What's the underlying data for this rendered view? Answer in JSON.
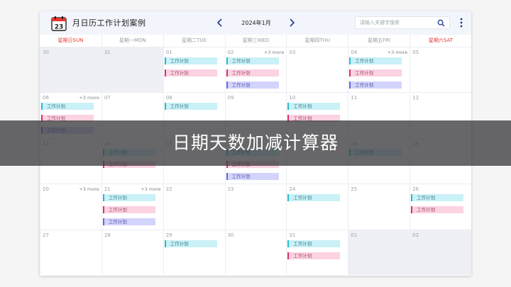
{
  "app": {
    "title": "月日历工作计划案例",
    "logo_day": "23",
    "current_month": "2024年1月",
    "search_placeholder": "请输入关键字搜索",
    "search_value": ""
  },
  "weekdays": [
    "星期日SUN",
    "星期一MON",
    "星期二TUE",
    "星期三WED",
    "星期四THU",
    "星期五FRI",
    "星期六SAT"
  ],
  "weekend_color": "#e53935",
  "event_colors": {
    "cyan": "#27b9cf",
    "pink": "#e02a6c",
    "purple": "#6366e8"
  },
  "weeks": [
    [
      {
        "day": "30",
        "other": true,
        "events": []
      },
      {
        "day": "31",
        "other": true,
        "events": []
      },
      {
        "day": "01",
        "events": [
          {
            "label": "工作计划",
            "color": "cyan"
          },
          {
            "label": "工作计划",
            "color": "pink"
          }
        ]
      },
      {
        "day": "02",
        "more": "+3 more",
        "events": [
          {
            "label": "工作计划",
            "color": "cyan"
          },
          {
            "label": "工作计划",
            "color": "pink"
          },
          {
            "label": "工作计划",
            "color": "purple"
          }
        ]
      },
      {
        "day": "03",
        "events": []
      },
      {
        "day": "04",
        "more": "+3 more",
        "events": [
          {
            "label": "工作计划",
            "color": "cyan"
          },
          {
            "label": "工作计划",
            "color": "pink"
          },
          {
            "label": "工作计划",
            "color": "purple"
          }
        ]
      },
      {
        "day": "05",
        "events": []
      }
    ],
    [
      {
        "day": "06",
        "more": "+3 more",
        "events": [
          {
            "label": "工作计划",
            "color": "cyan"
          },
          {
            "label": "工作计划",
            "color": "pink"
          },
          {
            "label": "工作计划",
            "color": "purple"
          }
        ]
      },
      {
        "day": "07",
        "events": []
      },
      {
        "day": "08",
        "events": [
          {
            "label": "工作计划",
            "color": "cyan"
          }
        ]
      },
      {
        "day": "09",
        "events": []
      },
      {
        "day": "10",
        "events": [
          {
            "label": "工作计划",
            "color": "cyan"
          },
          {
            "label": "工作计划",
            "color": "pink"
          }
        ]
      },
      {
        "day": "11",
        "events": []
      },
      {
        "day": "12",
        "events": []
      }
    ],
    [
      {
        "day": "13",
        "events": []
      },
      {
        "day": "14",
        "events": [
          {
            "label": "工作计划",
            "color": "cyan"
          },
          {
            "label": "工作计划",
            "color": "pink"
          }
        ]
      },
      {
        "day": "15",
        "events": []
      },
      {
        "day": "16",
        "events": [
          {
            "label": "工作计划",
            "color": "cyan"
          },
          {
            "label": "工作计划",
            "color": "pink"
          },
          {
            "label": "工作计划",
            "color": "purple"
          }
        ]
      },
      {
        "day": "17",
        "events": []
      },
      {
        "day": "18",
        "events": [
          {
            "label": "工作计划",
            "color": "cyan"
          }
        ]
      },
      {
        "day": "19",
        "events": []
      }
    ],
    [
      {
        "day": "20",
        "more": "+3 more",
        "events": []
      },
      {
        "day": "21",
        "more": "+3 more",
        "events": [
          {
            "label": "工作计划",
            "color": "cyan"
          },
          {
            "label": "工作计划",
            "color": "pink"
          },
          {
            "label": "工作计划",
            "color": "purple"
          }
        ]
      },
      {
        "day": "22",
        "events": []
      },
      {
        "day": "23",
        "events": []
      },
      {
        "day": "24",
        "events": [
          {
            "label": "工作计划",
            "color": "cyan"
          }
        ]
      },
      {
        "day": "25",
        "events": []
      },
      {
        "day": "26",
        "events": [
          {
            "label": "工作计划",
            "color": "cyan"
          },
          {
            "label": "工作计划",
            "color": "pink"
          }
        ]
      }
    ],
    [
      {
        "day": "27",
        "events": []
      },
      {
        "day": "28",
        "events": []
      },
      {
        "day": "29",
        "events": [
          {
            "label": "工作计划",
            "color": "cyan"
          }
        ]
      },
      {
        "day": "30",
        "events": []
      },
      {
        "day": "31",
        "events": [
          {
            "label": "工作计划",
            "color": "cyan"
          },
          {
            "label": "工作计划",
            "color": "pink"
          }
        ]
      },
      {
        "day": "01",
        "other": true,
        "events": []
      },
      {
        "day": "02",
        "other": true,
        "events": []
      }
    ]
  ],
  "overlay": {
    "text": "日期天数加减计算器"
  }
}
